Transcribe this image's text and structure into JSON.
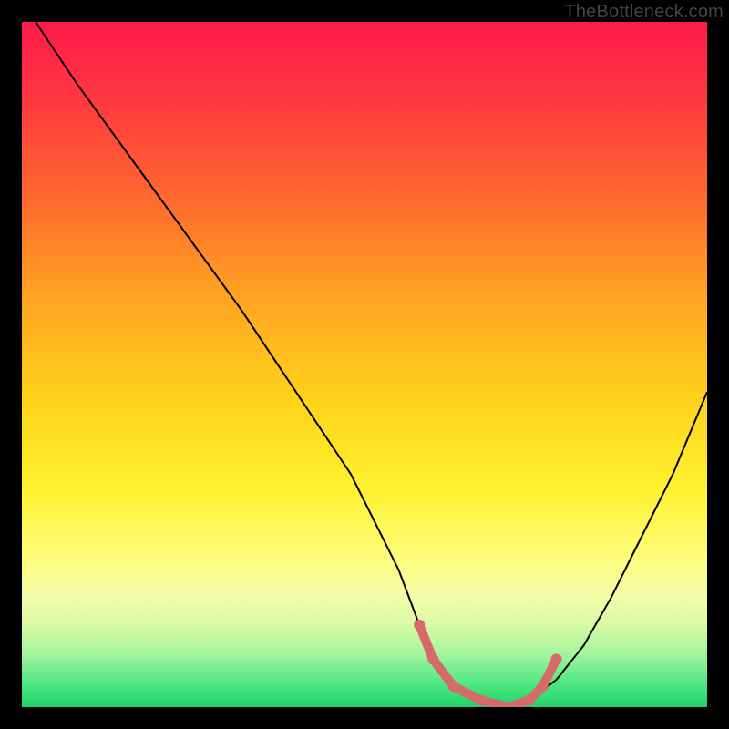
{
  "watermark": "TheBottleneck.com",
  "chart_data": {
    "type": "line",
    "title": "",
    "xlabel": "",
    "ylabel": "",
    "xlim": [
      0,
      100
    ],
    "ylim": [
      0,
      100
    ],
    "grid": false,
    "series": [
      {
        "name": "bottleneck-curve",
        "x": [
          2,
          8,
          16,
          24,
          32,
          40,
          48,
          55,
          58,
          60,
          62,
          66,
          70,
          74,
          78,
          82,
          86,
          90,
          95,
          100
        ],
        "y": [
          100,
          91,
          80,
          69,
          58,
          46,
          34,
          20,
          12,
          7,
          4,
          1,
          0,
          1,
          4,
          9,
          16,
          24,
          34,
          46
        ],
        "color": "#000000"
      }
    ],
    "highlight": {
      "name": "optimal-range",
      "points_x": [
        58,
        60,
        63,
        67,
        71,
        74,
        76,
        78
      ],
      "points_y": [
        12,
        7,
        3,
        1,
        0,
        1,
        3,
        7
      ],
      "color": "#d66a6a"
    },
    "background_gradient": {
      "top_color": "#ff1a4b",
      "mid_color": "#ffd21a",
      "bottom_color": "#1ed36a"
    }
  }
}
